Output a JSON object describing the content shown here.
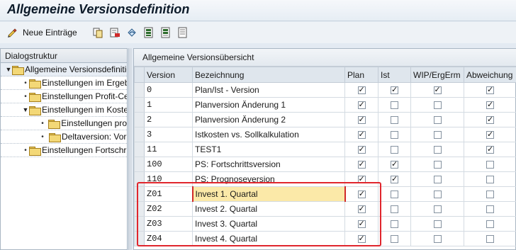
{
  "window": {
    "title": "Allgemeine Versionsdefinition"
  },
  "toolbar": {
    "new_entries_label": "Neue Einträge",
    "icons": [
      "glasses-edit-icon",
      "copy-icon",
      "delete-icon",
      "undo-icon",
      "select-all-icon",
      "select-block-icon",
      "deselect-icon"
    ]
  },
  "tree": {
    "header": "Dialogstruktur",
    "items": [
      {
        "label": "Allgemeine Versionsdefinition",
        "level": 0,
        "expanded": true,
        "selected": true
      },
      {
        "label": "Einstellungen im Ergebnisbereich",
        "level": 1,
        "expanded": false
      },
      {
        "label": "Einstellungen Profit-Center",
        "level": 1,
        "expanded": false
      },
      {
        "label": "Einstellungen im Kostenrechnungskreis",
        "level": 1,
        "expanded": true
      },
      {
        "label": "Einstellungen pro",
        "level": 2,
        "expanded": false
      },
      {
        "label": "Deltaversion: Vor",
        "level": 2,
        "expanded": false
      },
      {
        "label": "Einstellungen Fortschrittsanalyse",
        "level": 0,
        "expanded": false
      }
    ]
  },
  "table": {
    "title": "Allgemeine Versionsübersicht",
    "columns": [
      "Version",
      "Bezeichnung",
      "Plan",
      "Ist",
      "WIP/ErgErm",
      "Abweichung"
    ],
    "rows": [
      {
        "version": "0",
        "bezeichnung": "Plan/Ist - Version",
        "plan": true,
        "ist": true,
        "wip": true,
        "abw": true
      },
      {
        "version": "1",
        "bezeichnung": "Planversion Änderung 1",
        "plan": true,
        "ist": false,
        "wip": false,
        "abw": true
      },
      {
        "version": "2",
        "bezeichnung": "Planversion Änderung 2",
        "plan": true,
        "ist": false,
        "wip": false,
        "abw": true
      },
      {
        "version": "3",
        "bezeichnung": "Istkosten vs. Sollkalkulation",
        "plan": true,
        "ist": false,
        "wip": false,
        "abw": true
      },
      {
        "version": "11",
        "bezeichnung": "TEST1",
        "plan": true,
        "ist": false,
        "wip": false,
        "abw": true
      },
      {
        "version": "100",
        "bezeichnung": "PS: Fortschrittsversion",
        "plan": true,
        "ist": true,
        "wip": false,
        "abw": false
      },
      {
        "version": "110",
        "bezeichnung": "PS: Prognoseversion",
        "plan": true,
        "ist": true,
        "wip": false,
        "abw": false
      },
      {
        "version": "Z01",
        "bezeichnung": "Invest 1. Quartal",
        "plan": true,
        "ist": false,
        "wip": false,
        "abw": false
      },
      {
        "version": "Z02",
        "bezeichnung": "Invest 2. Quartal",
        "plan": true,
        "ist": false,
        "wip": false,
        "abw": false
      },
      {
        "version": "Z03",
        "bezeichnung": "Invest 3. Quartal",
        "plan": true,
        "ist": false,
        "wip": false,
        "abw": false
      },
      {
        "version": "Z04",
        "bezeichnung": "Invest 4. Quartal",
        "plan": true,
        "ist": false,
        "wip": false,
        "abw": false
      }
    ]
  },
  "colors": {
    "highlight_box": "#e0262d",
    "focus_cell": "#fbe9a8"
  }
}
